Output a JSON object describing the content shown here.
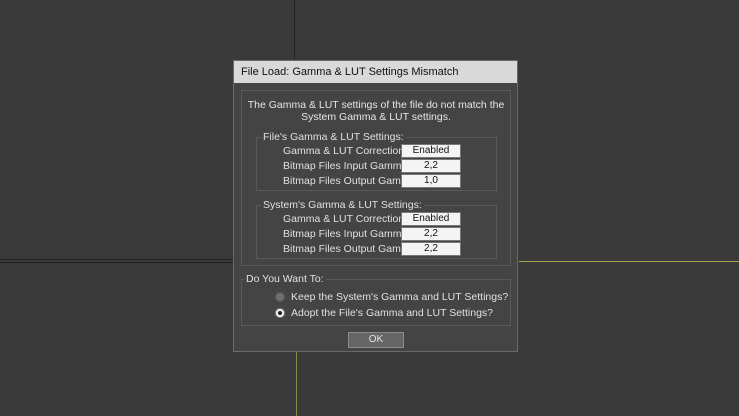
{
  "dialog": {
    "title": "File Load: Gamma & LUT Settings Mismatch",
    "message_line1": "The Gamma & LUT settings of the file do not match the",
    "message_line2": "System Gamma & LUT settings.",
    "file_settings": {
      "title": "File's Gamma & LUT Settings:",
      "rows": [
        {
          "label": "Gamma & LUT Correction:",
          "value": "Enabled"
        },
        {
          "label": "Bitmap Files Input Gamma:",
          "value": "2,2"
        },
        {
          "label": "Bitmap Files Output Gamma:",
          "value": "1,0"
        }
      ]
    },
    "system_settings": {
      "title": "System's Gamma & LUT Settings:",
      "rows": [
        {
          "label": "Gamma & LUT Correction:",
          "value": "Enabled"
        },
        {
          "label": "Bitmap Files Input Gamma:",
          "value": "2,2"
        },
        {
          "label": "Bitmap Files Output Gamma:",
          "value": "2,2"
        }
      ]
    },
    "choice": {
      "title": "Do You Want To:",
      "options": [
        {
          "label": "Keep the System's Gamma and LUT Settings?",
          "checked": false
        },
        {
          "label": "Adopt the File's Gamma and LUT Settings?",
          "checked": true
        }
      ]
    },
    "ok_label": "OK"
  },
  "colors": {
    "viewport_bg": "#3a3a3a",
    "dialog_bg": "#444444",
    "titlebar_bg": "#d9d9d9",
    "viewport_active_line": "#a6a148"
  }
}
